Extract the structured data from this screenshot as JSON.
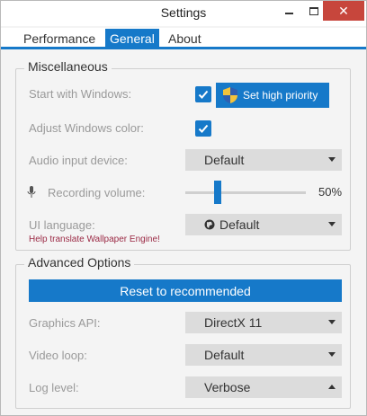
{
  "window": {
    "title": "Settings",
    "minimize_glyph": "",
    "close_glyph": "✕"
  },
  "tabs": [
    {
      "label": "Performance",
      "active": false
    },
    {
      "label": "General",
      "active": true
    },
    {
      "label": "About",
      "active": false
    }
  ],
  "misc": {
    "legend": "Miscellaneous",
    "start_with_windows": {
      "label": "Start with Windows:",
      "checked": true
    },
    "priority_button": "Set high priority",
    "adjust_color": {
      "label": "Adjust Windows color:",
      "checked": true
    },
    "audio_device": {
      "label": "Audio input device:",
      "value": "Default"
    },
    "recording_volume": {
      "label": "Recording volume:",
      "value_text": "50%",
      "level": 0.25
    },
    "ui_language": {
      "label": "UI language:",
      "value": "Default"
    },
    "help_link": "Help translate Wallpaper Engine!"
  },
  "advanced": {
    "legend": "Advanced Options",
    "reset_button": "Reset to recommended",
    "graphics_api": {
      "label": "Graphics API:",
      "value": "DirectX 11"
    },
    "video_loop": {
      "label": "Video loop:",
      "value": "Default"
    },
    "log_level": {
      "label": "Log level:",
      "value": "Verbose"
    }
  },
  "colors": {
    "accent": "#1679c9",
    "close": "#c7463c",
    "link": "#9b2a45"
  },
  "icons": [
    "gear-icon",
    "shield-icon",
    "microphone-icon",
    "globe-icon",
    "checkmark-icon",
    "chevron-down-icon",
    "chevron-up-icon"
  ]
}
